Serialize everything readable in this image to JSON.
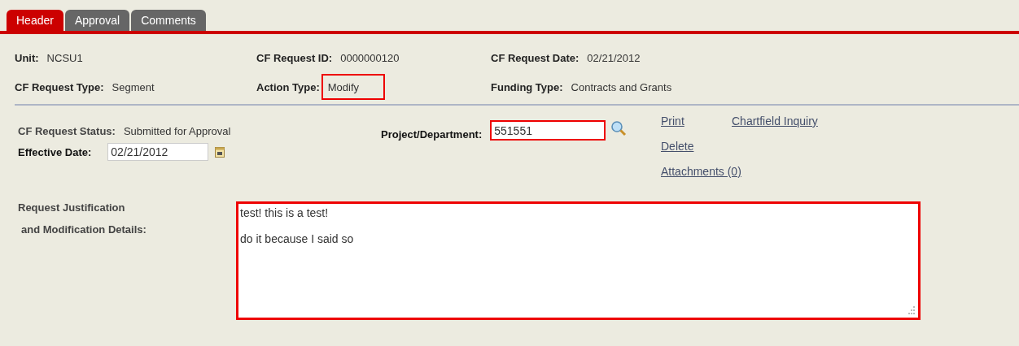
{
  "tabs": [
    {
      "label": "Header",
      "selected": true
    },
    {
      "label": "Approval",
      "selected": false
    },
    {
      "label": "Comments",
      "selected": false
    }
  ],
  "summary": [
    {
      "label": "Unit:",
      "value": "NCSU1",
      "highlighted": false
    },
    {
      "label": "CF Request ID:",
      "value": "0000000120",
      "highlighted": false
    },
    {
      "label": "CF Request Date:",
      "value": "02/21/2012",
      "highlighted": false
    },
    {
      "label": "CF Request Type:",
      "value": "Segment",
      "highlighted": false
    },
    {
      "label": "Action Type:",
      "value": "Modify",
      "highlighted": true
    },
    {
      "label": "Funding Type:",
      "value": "Contracts and Grants",
      "highlighted": false
    }
  ],
  "status": {
    "label": "CF Request Status:",
    "value": "Submitted for Approval"
  },
  "effective_date": {
    "label": "Effective Date:",
    "value": "02/21/2012"
  },
  "project": {
    "label": "Project/Department:",
    "value": "551551",
    "highlighted": true
  },
  "links": [
    {
      "label": "Print"
    },
    {
      "label": "Chartfield Inquiry"
    },
    {
      "label": "Delete"
    },
    {
      "label": "Attachments (0)"
    }
  ],
  "justification": {
    "label_lines": [
      "Request Justification",
      "and Modification Details:"
    ],
    "value": "test! this is a test!\n\ndo it because I said so",
    "highlighted": true
  }
}
